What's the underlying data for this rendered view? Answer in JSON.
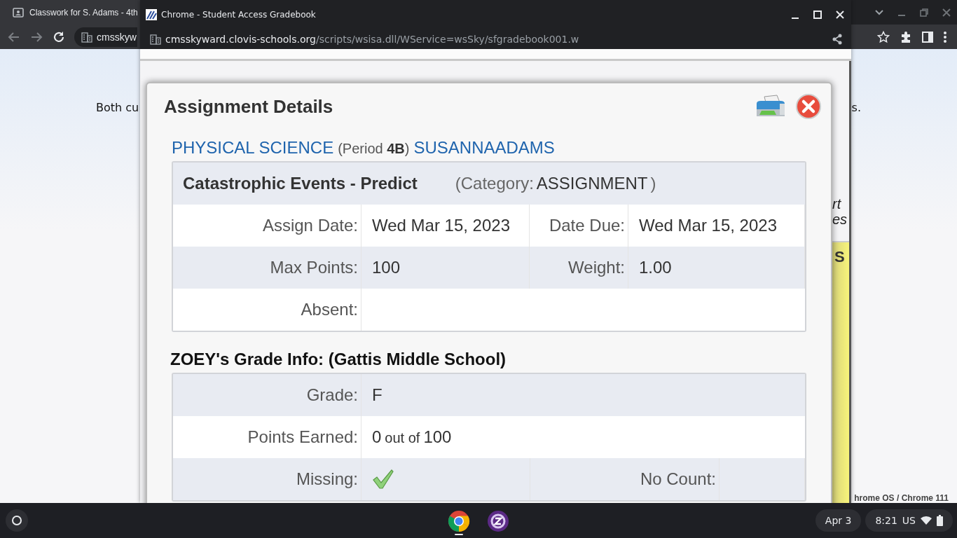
{
  "background_browser": {
    "tab": {
      "title": "Classwork for S. Adams - 4th"
    },
    "address": "cmsskyw",
    "page": {
      "intro_start": "Both cu",
      "intro_end": "s.",
      "footer": "hrome OS / Chrome 111"
    }
  },
  "popup": {
    "title": "Chrome - Student Access Gradebook",
    "url_host": "cmsskyward.clovis-schools.org",
    "url_path": "/scripts/wsisa.dll/WService=wsSky/sfgradebook001.w",
    "page": {
      "fragment_lines": [
        "rt",
        "es"
      ],
      "column_header": "S"
    }
  },
  "dialog": {
    "title": "Assignment Details",
    "course": "PHYSICAL SCIENCE",
    "period": "(Period **4B**)",
    "teacher": "SUSANNAADAMS",
    "assignment": {
      "name": "Catastrophic Events - Predict",
      "category_label": "(Category:",
      "category": "ASSIGNMENT",
      "category_close": ")",
      "rows": [
        {
          "cells": [
            {
              "kind": "text",
              "label": "Assign Date:",
              "value": "Wed Mar 15, 2023"
            },
            {
              "kind": "text",
              "label": "Date Due:",
              "value": "Wed Mar 15, 2023"
            }
          ]
        },
        {
          "cells": [
            {
              "kind": "text",
              "label": "Max Points:",
              "value": "100"
            },
            {
              "kind": "text",
              "label": "Weight:",
              "value": "1.00"
            }
          ]
        },
        {
          "cells": [
            {
              "kind": "text",
              "label": "Absent:"
            }
          ]
        }
      ]
    },
    "grade_heading": "ZOEY's Grade Info: (Gattis Middle School)",
    "grade_rows": [
      {
        "cells": [
          {
            "kind": "text",
            "label": "Grade:",
            "value": "F"
          }
        ]
      },
      {
        "cells": [
          {
            "kind": "score",
            "label": "Points Earned:",
            "value": "0",
            "joiner": "out of",
            "total": "100"
          }
        ]
      },
      {
        "cells": [
          {
            "kind": "check",
            "label": "Missing:",
            "checked": true
          },
          {
            "kind": "check",
            "label": "No Count:",
            "checked": false
          }
        ]
      }
    ]
  },
  "taskbar": {
    "date": "Apr 3",
    "time": "8:21",
    "locale": "US"
  }
}
